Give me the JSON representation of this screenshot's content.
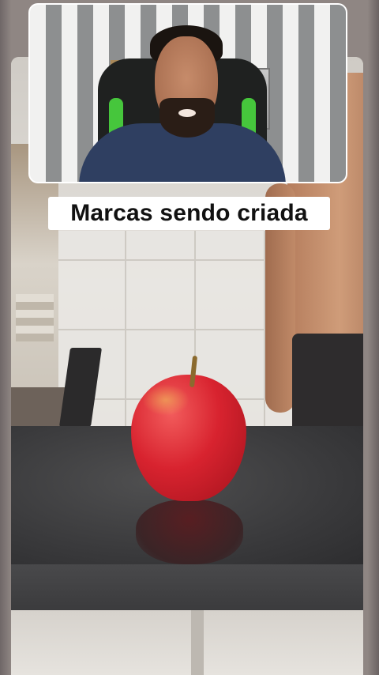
{
  "caption": {
    "text": "Marcas sendo criada"
  },
  "colors": {
    "caption_background": "#ffffff",
    "caption_text": "#111111",
    "overlay_border": "#ffffff",
    "apple": "#d8232f"
  }
}
